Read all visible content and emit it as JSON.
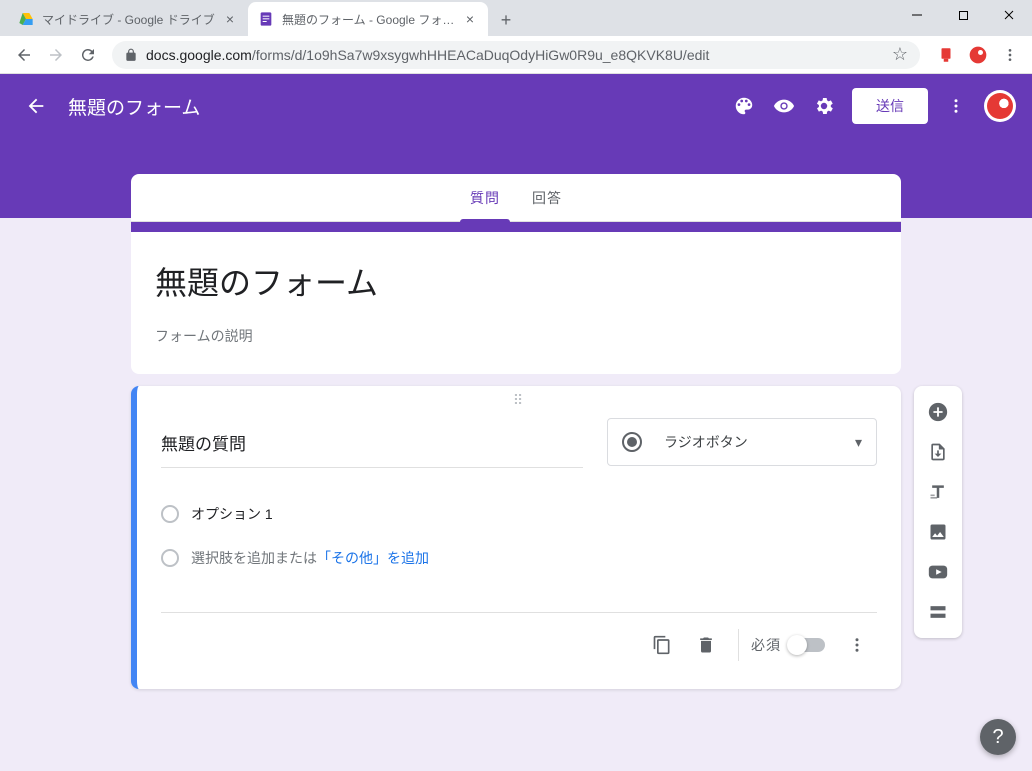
{
  "window": {
    "tabs": [
      {
        "title": "マイドライブ - Google ドライブ",
        "active": false
      },
      {
        "title": "無題のフォーム - Google フォーム",
        "active": true
      }
    ]
  },
  "addressbar": {
    "host": "docs.google.com",
    "path": "/forms/d/1o9hSa7w9xsygwhHHEACaDuqOdyHiGw0R9u_e8QKVK8U/edit"
  },
  "header": {
    "title": "無題のフォーム",
    "send_label": "送信"
  },
  "tabs": {
    "questions": "質問",
    "responses": "回答"
  },
  "form": {
    "title": "無題のフォーム",
    "description_placeholder": "フォームの説明"
  },
  "question": {
    "title": "無題の質問",
    "type_label": "ラジオボタン",
    "option1": "オプション 1",
    "add_option": "選択肢を追加",
    "or_text": " または ",
    "add_other": "「その他」を追加",
    "required_label": "必須"
  },
  "side_toolbar": {
    "add_question": "add-question",
    "import_questions": "import-questions",
    "add_title": "add-title",
    "add_image": "add-image",
    "add_video": "add-video",
    "add_section": "add-section"
  }
}
